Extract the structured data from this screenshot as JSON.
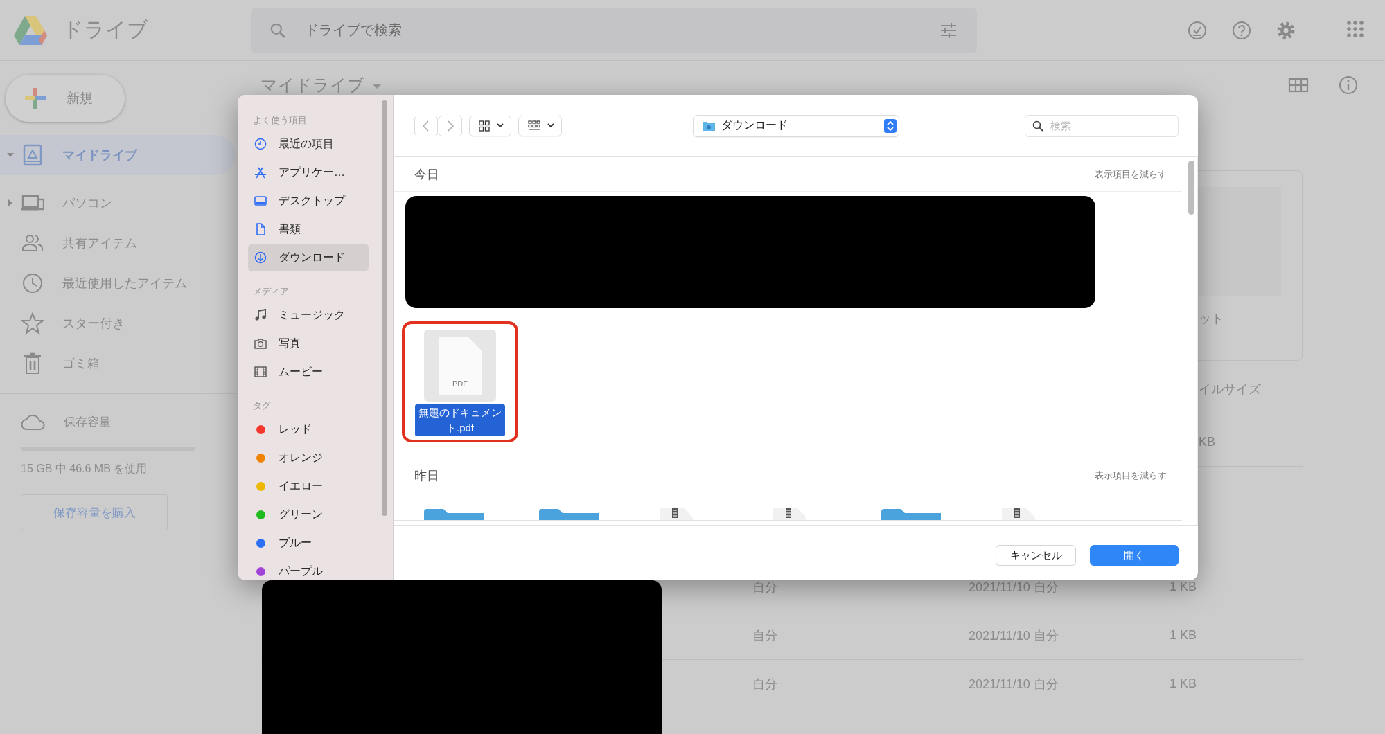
{
  "app": {
    "title": "ドライブ"
  },
  "search": {
    "placeholder": "ドライブで検索"
  },
  "new_button": {
    "label": "新規"
  },
  "nav": [
    {
      "label": "マイドライブ",
      "selected": true,
      "expanded": true
    },
    {
      "label": "パソコン",
      "selected": false,
      "expanded": false
    },
    {
      "label": "共有アイテム",
      "selected": false
    },
    {
      "label": "最近使用したアイテム",
      "selected": false
    },
    {
      "label": "スター付き",
      "selected": false
    },
    {
      "label": "ゴミ箱",
      "selected": false
    }
  ],
  "storage": {
    "label": "保存容量",
    "level": 0.003,
    "usage": "15 GB 中 46.6 MB を使用",
    "buy_button": "保存容量を購入"
  },
  "main": {
    "title": "マイドライブ",
    "card": {
      "caption": "ット"
    },
    "file_table": {
      "size_header": "イルサイズ",
      "rows": [
        {
          "size": "KB"
        },
        {
          "owner": "自分",
          "modified": "2021/11/10 自分",
          "size": "1 KB"
        },
        {
          "owner": "自分",
          "modified": "2021/11/10 自分",
          "size": "1 KB"
        },
        {
          "owner": "自分",
          "modified": "2021/11/10 自分",
          "size": "1 KB"
        }
      ]
    }
  },
  "dialog": {
    "sidebar": [
      {
        "title": "よく使う項目",
        "items": [
          {
            "label": "最近の項目",
            "selected": false
          },
          {
            "label": "アプリケー…",
            "selected": false
          },
          {
            "label": "デスクトップ",
            "selected": false
          },
          {
            "label": "書類",
            "selected": false
          },
          {
            "label": "ダウンロード",
            "selected": true
          }
        ]
      },
      {
        "title": "メディア",
        "items": [
          {
            "label": "ミュージック",
            "selected": false
          },
          {
            "label": "写真",
            "selected": false
          },
          {
            "label": "ムービー",
            "selected": false
          }
        ]
      },
      {
        "title": "タグ",
        "items": [
          {
            "label": "レッド",
            "selected": false,
            "color": "#f4362c"
          },
          {
            "label": "オレンジ",
            "selected": false,
            "color": "#ef8200"
          },
          {
            "label": "イエロー",
            "selected": false,
            "color": "#efb800"
          },
          {
            "label": "グリーン",
            "selected": false,
            "color": "#1fba1f"
          },
          {
            "label": "ブルー",
            "selected": false,
            "color": "#2a6ff5"
          },
          {
            "label": "パープル",
            "selected": false,
            "color": "#a243d8"
          }
        ]
      }
    ],
    "location": "ダウンロード",
    "search": {
      "placeholder": "検索"
    },
    "sections": [
      {
        "title": "今日",
        "action": "表示項目を減らす",
        "items": [
          {
            "kind": "redacted"
          },
          {
            "kind": "file",
            "name": "無題のドキュメント.pdf",
            "type_label": "PDF",
            "selected": true,
            "marked": true
          }
        ]
      },
      {
        "title": "昨日",
        "action": "表示項目を減らす",
        "items": [
          {
            "kind": "folder"
          },
          {
            "kind": "folder"
          },
          {
            "kind": "archive"
          },
          {
            "kind": "archive"
          },
          {
            "kind": "folder"
          },
          {
            "kind": "archive"
          }
        ]
      }
    ],
    "buttons": [
      {
        "label": "キャンセル",
        "kind": "default"
      },
      {
        "label": "開く",
        "kind": "primary"
      }
    ]
  }
}
